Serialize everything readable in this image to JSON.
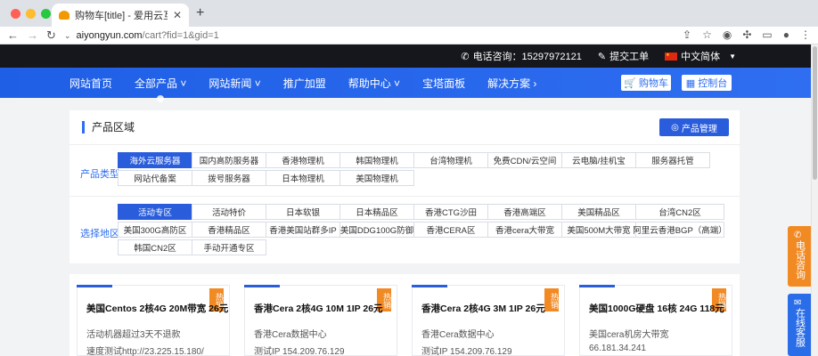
{
  "browser": {
    "tab_title": "购物车[title] - 爱用云互联-专注",
    "tab_close": "✕",
    "new_tab": "+",
    "url_host": "aiyongyun.com",
    "url_path": "/cart?fid=1&gid=1"
  },
  "topbar": {
    "phone_label": "电话咨询：15297972121",
    "ticket_label": "提交工单",
    "language_label": "中文简体"
  },
  "nav": {
    "items": [
      {
        "label": "网站首页"
      },
      {
        "label": "全部产品 ˅"
      },
      {
        "label": "网站新闻 ˅"
      },
      {
        "label": "推广加盟"
      },
      {
        "label": "帮助中心 ˅"
      },
      {
        "label": "宝塔面板"
      },
      {
        "label": "解决方案 ›"
      }
    ],
    "cart_label": "购物车",
    "console_label": "控制台"
  },
  "panel": {
    "title": "产品区域",
    "manage_label": "产品管理",
    "type_label": "产品类型",
    "region_label": "选择地区",
    "types": [
      "海外云服务器",
      "国内高防服务器",
      "香港物理机",
      "韩国物理机",
      "台湾物理机",
      "免费CDN/云空间",
      "云电脑/挂机宝",
      "服务器托管",
      "网站代备案",
      "拨号服务器",
      "日本物理机",
      "美国物理机"
    ],
    "regions": [
      "活动专区",
      "活动特价",
      "日本软银",
      "日本精品区",
      "香港CTG沙田",
      "香港高端区",
      "美国精品区",
      "台湾CN2区",
      "美国300G高防区",
      "香港精品区",
      "香港美国站群多IP",
      "美国DDG100G防御",
      "香港CERA区",
      "香港cera大带宽",
      "美国500M大带宽",
      "阿里云香港BGP（高端）",
      "韩国CN2区",
      "手动开通专区"
    ]
  },
  "cards": [
    {
      "hot": "热销",
      "title": "美国Centos 2核4G 20M带宽 26元",
      "line1": "活动机器超过3天不退款",
      "line2": "速度测试http://23.225.15.180/"
    },
    {
      "hot": "热销",
      "title": "香港Cera 2核4G 10M 1IP 26元",
      "line1": "香港Cera数据中心",
      "line2": "测试IP 154.209.76.129"
    },
    {
      "hot": "热销",
      "title": "香港Cera 2核4G 3M 1IP 26元",
      "line1": "香港Cera数据中心",
      "line2": "测试IP 154.209.76.129"
    },
    {
      "hot": "热销",
      "title": "美国1000G硬盘 16核 24G 118元",
      "line1": "美国cera机房大带宽",
      "line2": "66.181.34.241"
    }
  ],
  "floats": {
    "phone_label": "电话咨询",
    "online_label": "在线客服"
  },
  "colors": {
    "brand_blue": "#2f6ef0",
    "hot_orange": "#f28a24",
    "topbar_dark": "#15171c"
  }
}
